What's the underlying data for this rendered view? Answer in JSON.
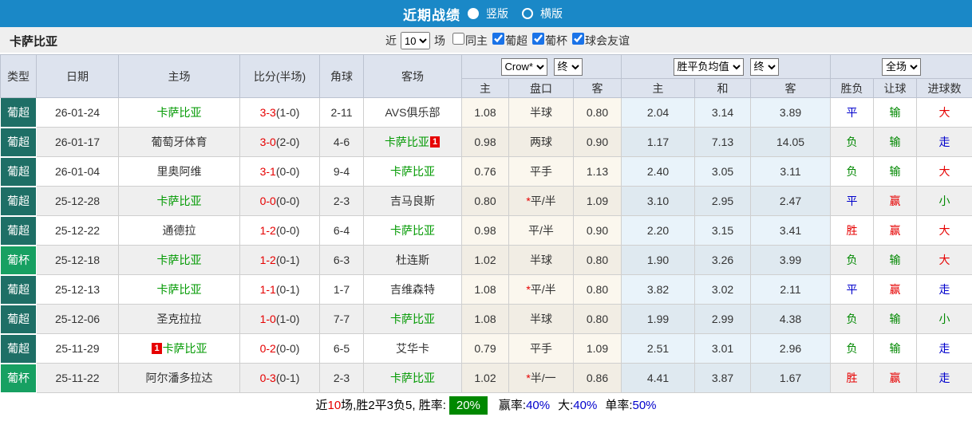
{
  "top_bar": {
    "title": "近期战绩",
    "radio_vertical": "竖版",
    "radio_horizontal": "横版",
    "bg": "#1a88c7"
  },
  "toolbar": {
    "team_name": "卡萨比亚",
    "near_label": "近",
    "matches_select": "10",
    "matches_label": "场",
    "filters": [
      {
        "label": "同主",
        "checked": false
      },
      {
        "label": "葡超",
        "checked": true
      },
      {
        "label": "葡杯",
        "checked": true
      },
      {
        "label": "球会友谊",
        "checked": true
      }
    ]
  },
  "colors": {
    "league": {
      "葡超": "#1e6f66",
      "葡杯": "#17a062"
    },
    "result": {
      "red": "#e60000",
      "green": "#008800",
      "blue": "#0000cc"
    },
    "team_self": "#009900",
    "score": "#e60000",
    "accent_blue": "#1a88c7"
  },
  "table": {
    "headers": {
      "type": "类型",
      "date": "日期",
      "home": "主场",
      "score": "比分(半场)",
      "corner": "角球",
      "away": "客场",
      "odds_select": "Crow*",
      "odds_final_select": "终",
      "odds_sub": [
        "主",
        "盘口",
        "客"
      ],
      "mean_select": "胜平负均值",
      "mean_final_select": "终",
      "mean_sub": [
        "主",
        "和",
        "客"
      ],
      "fulltime_select": "全场",
      "result_sub": [
        "胜负",
        "让球",
        "进球数"
      ]
    },
    "rows": [
      {
        "type": "葡超",
        "date": "26-01-24",
        "home": {
          "name": "卡萨比亚",
          "self": true,
          "card": null,
          "card_pos": null
        },
        "score": "3-3",
        "half": "(1-0)",
        "corner": "2-11",
        "away": {
          "name": "AVS俱乐部",
          "self": false,
          "card": null,
          "card_pos": null
        },
        "odds": [
          "1.08",
          "半球",
          "0.80"
        ],
        "mean": [
          "2.04",
          "3.14",
          "3.89"
        ],
        "results": [
          {
            "text": "平",
            "c": "blue"
          },
          {
            "text": "输",
            "c": "green"
          },
          {
            "text": "大",
            "c": "red"
          }
        ]
      },
      {
        "type": "葡超",
        "date": "26-01-17",
        "home": {
          "name": "葡萄牙体育",
          "self": false,
          "card": null,
          "card_pos": null
        },
        "score": "3-0",
        "half": "(2-0)",
        "corner": "4-6",
        "away": {
          "name": "卡萨比亚",
          "self": true,
          "card": "1",
          "card_pos": "suffix"
        },
        "odds": [
          "0.98",
          "两球",
          "0.90"
        ],
        "mean": [
          "1.17",
          "7.13",
          "14.05"
        ],
        "results": [
          {
            "text": "负",
            "c": "green"
          },
          {
            "text": "输",
            "c": "green"
          },
          {
            "text": "走",
            "c": "blue"
          }
        ]
      },
      {
        "type": "葡超",
        "date": "26-01-04",
        "home": {
          "name": "里奥阿维",
          "self": false,
          "card": null,
          "card_pos": null
        },
        "score": "3-1",
        "half": "(0-0)",
        "corner": "9-4",
        "away": {
          "name": "卡萨比亚",
          "self": true,
          "card": null,
          "card_pos": null
        },
        "odds": [
          "0.76",
          "平手",
          "1.13"
        ],
        "mean": [
          "2.40",
          "3.05",
          "3.11"
        ],
        "results": [
          {
            "text": "负",
            "c": "green"
          },
          {
            "text": "输",
            "c": "green"
          },
          {
            "text": "大",
            "c": "red"
          }
        ]
      },
      {
        "type": "葡超",
        "date": "25-12-28",
        "home": {
          "name": "卡萨比亚",
          "self": true,
          "card": null,
          "card_pos": null
        },
        "score": "0-0",
        "half": "(0-0)",
        "corner": "2-3",
        "away": {
          "name": "吉马良斯",
          "self": false,
          "card": null,
          "card_pos": null
        },
        "odds": [
          "0.80",
          "*平/半",
          "1.09"
        ],
        "mean": [
          "3.10",
          "2.95",
          "2.47"
        ],
        "results": [
          {
            "text": "平",
            "c": "blue"
          },
          {
            "text": "赢",
            "c": "red"
          },
          {
            "text": "小",
            "c": "green"
          }
        ]
      },
      {
        "type": "葡超",
        "date": "25-12-22",
        "home": {
          "name": "通德拉",
          "self": false,
          "card": null,
          "card_pos": null
        },
        "score": "1-2",
        "half": "(0-0)",
        "corner": "6-4",
        "away": {
          "name": "卡萨比亚",
          "self": true,
          "card": null,
          "card_pos": null
        },
        "odds": [
          "0.98",
          "平/半",
          "0.90"
        ],
        "mean": [
          "2.20",
          "3.15",
          "3.41"
        ],
        "results": [
          {
            "text": "胜",
            "c": "red"
          },
          {
            "text": "赢",
            "c": "red"
          },
          {
            "text": "大",
            "c": "red"
          }
        ]
      },
      {
        "type": "葡杯",
        "date": "25-12-18",
        "home": {
          "name": "卡萨比亚",
          "self": true,
          "card": null,
          "card_pos": null
        },
        "score": "1-2",
        "half": "(0-1)",
        "corner": "6-3",
        "away": {
          "name": "杜连斯",
          "self": false,
          "card": null,
          "card_pos": null
        },
        "odds": [
          "1.02",
          "半球",
          "0.80"
        ],
        "mean": [
          "1.90",
          "3.26",
          "3.99"
        ],
        "results": [
          {
            "text": "负",
            "c": "green"
          },
          {
            "text": "输",
            "c": "green"
          },
          {
            "text": "大",
            "c": "red"
          }
        ]
      },
      {
        "type": "葡超",
        "date": "25-12-13",
        "home": {
          "name": "卡萨比亚",
          "self": true,
          "card": null,
          "card_pos": null
        },
        "score": "1-1",
        "half": "(0-1)",
        "corner": "1-7",
        "away": {
          "name": "吉维森特",
          "self": false,
          "card": null,
          "card_pos": null
        },
        "odds": [
          "1.08",
          "*平/半",
          "0.80"
        ],
        "mean": [
          "3.82",
          "3.02",
          "2.11"
        ],
        "results": [
          {
            "text": "平",
            "c": "blue"
          },
          {
            "text": "赢",
            "c": "red"
          },
          {
            "text": "走",
            "c": "blue"
          }
        ]
      },
      {
        "type": "葡超",
        "date": "25-12-06",
        "home": {
          "name": "圣克拉拉",
          "self": false,
          "card": null,
          "card_pos": null
        },
        "score": "1-0",
        "half": "(1-0)",
        "corner": "7-7",
        "away": {
          "name": "卡萨比亚",
          "self": true,
          "card": null,
          "card_pos": null
        },
        "odds": [
          "1.08",
          "半球",
          "0.80"
        ],
        "mean": [
          "1.99",
          "2.99",
          "4.38"
        ],
        "results": [
          {
            "text": "负",
            "c": "green"
          },
          {
            "text": "输",
            "c": "green"
          },
          {
            "text": "小",
            "c": "green"
          }
        ]
      },
      {
        "type": "葡超",
        "date": "25-11-29",
        "home": {
          "name": "卡萨比亚",
          "self": true,
          "card": "1",
          "card_pos": "prefix"
        },
        "score": "0-2",
        "half": "(0-0)",
        "corner": "6-5",
        "away": {
          "name": "艾华卡",
          "self": false,
          "card": null,
          "card_pos": null
        },
        "odds": [
          "0.79",
          "平手",
          "1.09"
        ],
        "mean": [
          "2.51",
          "3.01",
          "2.96"
        ],
        "results": [
          {
            "text": "负",
            "c": "green"
          },
          {
            "text": "输",
            "c": "green"
          },
          {
            "text": "走",
            "c": "blue"
          }
        ]
      },
      {
        "type": "葡杯",
        "date": "25-11-22",
        "home": {
          "name": "阿尔潘多拉达",
          "self": false,
          "card": null,
          "card_pos": null
        },
        "score": "0-3",
        "half": "(0-1)",
        "corner": "2-3",
        "away": {
          "name": "卡萨比亚",
          "self": true,
          "card": null,
          "card_pos": null
        },
        "odds": [
          "1.02",
          "*半/一",
          "0.86"
        ],
        "mean": [
          "4.41",
          "3.87",
          "1.67"
        ],
        "results": [
          {
            "text": "胜",
            "c": "red"
          },
          {
            "text": "赢",
            "c": "red"
          },
          {
            "text": "走",
            "c": "blue"
          }
        ]
      }
    ]
  },
  "summary": {
    "prefix": "近",
    "count": "10",
    "mid": "场,胜2平3负5, 胜率:",
    "win_rate": "20%",
    "seg2_label": "赢率:",
    "seg2_value": "40%",
    "seg3_label": "大:",
    "seg3_value": "40%",
    "seg4_label": "单率:",
    "seg4_value": "50%"
  }
}
